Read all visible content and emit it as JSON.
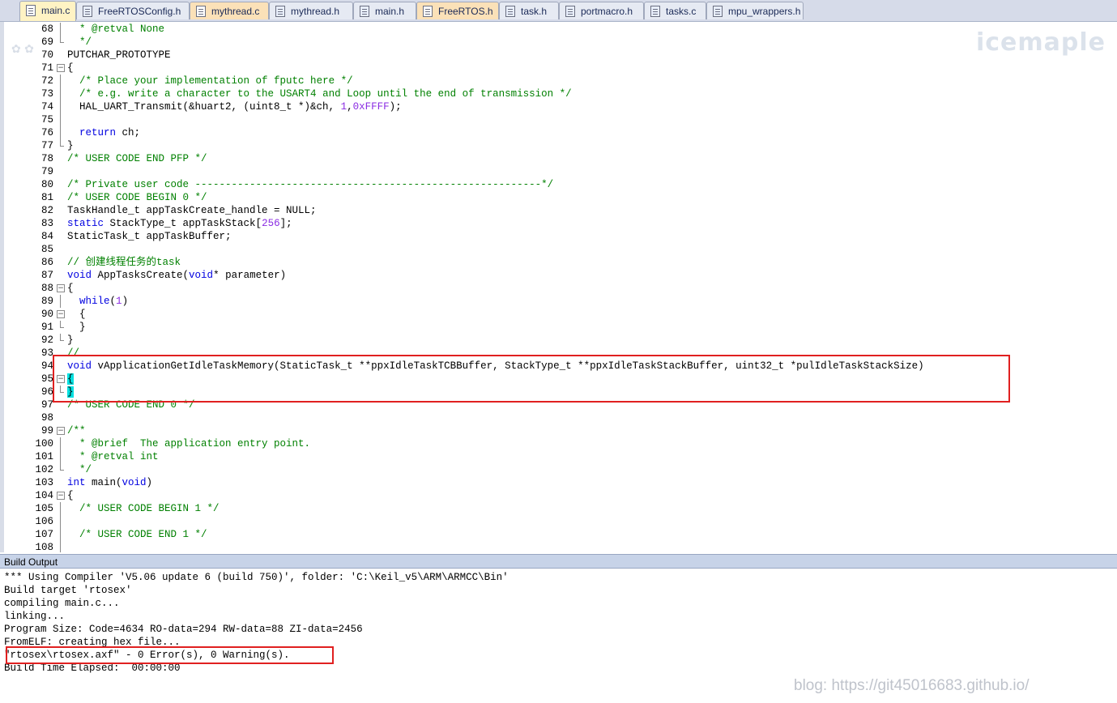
{
  "tabs": [
    {
      "label": "main.c",
      "kind": "c",
      "active": true
    },
    {
      "label": "FreeRTOSConfig.h",
      "kind": "h"
    },
    {
      "label": "mythread.c",
      "kind": "c"
    },
    {
      "label": "mythread.h",
      "kind": "h"
    },
    {
      "label": "main.h",
      "kind": "h"
    },
    {
      "label": "FreeRTOS.h",
      "kind": "c"
    },
    {
      "label": "task.h",
      "kind": "h"
    },
    {
      "label": "portmacro.h",
      "kind": "h"
    },
    {
      "label": "tasks.c",
      "kind": "h"
    },
    {
      "label": "mpu_wrappers.h",
      "kind": "h"
    }
  ],
  "watermark_top": "icemaple",
  "editor": {
    "lines": [
      {
        "n": "68",
        "fold": "vline",
        "segs": [
          [
            "c",
            "  * @retval None"
          ]
        ]
      },
      {
        "n": "69",
        "fold": "end",
        "segs": [
          [
            "c",
            "  */"
          ]
        ]
      },
      {
        "n": "70",
        "fold": "",
        "segs": [
          [
            "p",
            "PUTCHAR_PROTOTYPE"
          ]
        ]
      },
      {
        "n": "71",
        "fold": "box",
        "segs": [
          [
            "p",
            "{"
          ]
        ]
      },
      {
        "n": "72",
        "fold": "vline",
        "segs": [
          [
            "p",
            "  "
          ],
          [
            "c",
            "/* Place your implementation of fputc here */"
          ]
        ]
      },
      {
        "n": "73",
        "fold": "vline",
        "segs": [
          [
            "p",
            "  "
          ],
          [
            "c",
            "/* e.g. write a character to the USART4 and Loop until the end of transmission */"
          ]
        ]
      },
      {
        "n": "74",
        "fold": "vline",
        "segs": [
          [
            "p",
            "  HAL_UART_Transmit(&huart2, (uint8_t *)&ch, "
          ],
          [
            "n",
            "1"
          ],
          [
            "p",
            ","
          ],
          [
            "n",
            "0xFFFF"
          ],
          [
            "p",
            ");"
          ]
        ]
      },
      {
        "n": "75",
        "fold": "vline",
        "segs": [
          [
            "p",
            ""
          ]
        ]
      },
      {
        "n": "76",
        "fold": "vline",
        "segs": [
          [
            "p",
            "  "
          ],
          [
            "k",
            "return"
          ],
          [
            "p",
            " ch;"
          ]
        ]
      },
      {
        "n": "77",
        "fold": "end",
        "segs": [
          [
            "p",
            "}"
          ]
        ]
      },
      {
        "n": "78",
        "fold": "",
        "segs": [
          [
            "c",
            "/* USER CODE END PFP */"
          ]
        ]
      },
      {
        "n": "79",
        "fold": "",
        "segs": [
          [
            "p",
            ""
          ]
        ]
      },
      {
        "n": "80",
        "fold": "",
        "segs": [
          [
            "c",
            "/* Private user code ---------------------------------------------------------*/"
          ]
        ]
      },
      {
        "n": "81",
        "fold": "",
        "segs": [
          [
            "c",
            "/* USER CODE BEGIN 0 */"
          ]
        ]
      },
      {
        "n": "82",
        "fold": "",
        "segs": [
          [
            "p",
            "TaskHandle_t appTaskCreate_handle = NULL;"
          ]
        ]
      },
      {
        "n": "83",
        "fold": "",
        "segs": [
          [
            "k",
            "static"
          ],
          [
            "p",
            " StackType_t appTaskStack["
          ],
          [
            "n",
            "256"
          ],
          [
            "p",
            "];"
          ]
        ]
      },
      {
        "n": "84",
        "fold": "",
        "segs": [
          [
            "p",
            "StaticTask_t appTaskBuffer;"
          ]
        ]
      },
      {
        "n": "85",
        "fold": "",
        "segs": [
          [
            "p",
            ""
          ]
        ]
      },
      {
        "n": "86",
        "fold": "",
        "segs": [
          [
            "c",
            "// 创建线程任务的task"
          ]
        ]
      },
      {
        "n": "87",
        "fold": "",
        "segs": [
          [
            "k",
            "void"
          ],
          [
            "p",
            " AppTasksCreate("
          ],
          [
            "k",
            "void"
          ],
          [
            "p",
            "* parameter)"
          ]
        ]
      },
      {
        "n": "88",
        "fold": "box",
        "segs": [
          [
            "p",
            "{"
          ]
        ]
      },
      {
        "n": "89",
        "fold": "vline",
        "segs": [
          [
            "p",
            "  "
          ],
          [
            "k",
            "while"
          ],
          [
            "p",
            "("
          ],
          [
            "n",
            "1"
          ],
          [
            "p",
            ")"
          ]
        ]
      },
      {
        "n": "90",
        "fold": "box",
        "segs": [
          [
            "p",
            "  {"
          ]
        ]
      },
      {
        "n": "91",
        "fold": "end",
        "segs": [
          [
            "p",
            "  }"
          ]
        ]
      },
      {
        "n": "92",
        "fold": "end",
        "segs": [
          [
            "p",
            "}"
          ]
        ]
      },
      {
        "n": "93",
        "fold": "",
        "segs": [
          [
            "c",
            "//"
          ]
        ]
      },
      {
        "n": "94",
        "fold": "",
        "segs": [
          [
            "k",
            "void"
          ],
          [
            "p",
            " vApplicationGetIdleTaskMemory(StaticTask_t **ppxIdleTaskTCBBuffer, StackType_t **ppxIdleTaskStackBuffer, uint32_t *pulIdleTaskStackSize)"
          ]
        ]
      },
      {
        "n": "95",
        "fold": "box",
        "segs": [
          [
            "h",
            "{"
          ]
        ]
      },
      {
        "n": "96",
        "fold": "end",
        "segs": [
          [
            "h",
            "}"
          ]
        ]
      },
      {
        "n": "97",
        "fold": "",
        "segs": [
          [
            "c",
            "/* USER CODE END 0 */"
          ]
        ]
      },
      {
        "n": "98",
        "fold": "",
        "segs": [
          [
            "p",
            ""
          ]
        ]
      },
      {
        "n": "99",
        "fold": "box",
        "segs": [
          [
            "c",
            "/**"
          ]
        ]
      },
      {
        "n": "100",
        "fold": "vline",
        "segs": [
          [
            "c",
            "  * @brief  The application entry point."
          ]
        ]
      },
      {
        "n": "101",
        "fold": "vline",
        "segs": [
          [
            "c",
            "  * @retval int"
          ]
        ]
      },
      {
        "n": "102",
        "fold": "end",
        "segs": [
          [
            "c",
            "  */"
          ]
        ]
      },
      {
        "n": "103",
        "fold": "",
        "segs": [
          [
            "k",
            "int"
          ],
          [
            "p",
            " main("
          ],
          [
            "k",
            "void"
          ],
          [
            "p",
            ")"
          ]
        ]
      },
      {
        "n": "104",
        "fold": "box",
        "segs": [
          [
            "p",
            "{"
          ]
        ]
      },
      {
        "n": "105",
        "fold": "vline",
        "segs": [
          [
            "p",
            "  "
          ],
          [
            "c",
            "/* USER CODE BEGIN 1 */"
          ]
        ]
      },
      {
        "n": "106",
        "fold": "vline",
        "segs": [
          [
            "p",
            ""
          ]
        ]
      },
      {
        "n": "107",
        "fold": "vline",
        "segs": [
          [
            "p",
            "  "
          ],
          [
            "c",
            "/* USER CODE END 1 */"
          ]
        ]
      },
      {
        "n": "108",
        "fold": "vline",
        "segs": [
          [
            "p",
            ""
          ]
        ]
      }
    ]
  },
  "build": {
    "header": "Build Output",
    "lines": [
      "*** Using Compiler 'V5.06 update 6 (build 750)', folder: 'C:\\Keil_v5\\ARM\\ARMCC\\Bin'",
      "Build target 'rtosex'",
      "compiling main.c...",
      "linking...",
      "Program Size: Code=4634 RO-data=294 RW-data=88 ZI-data=2456",
      "FromELF: creating hex file...",
      "\"rtosex\\rtosex.axf\" - 0 Error(s), 0 Warning(s).",
      "Build Time Elapsed:  00:00:00"
    ]
  },
  "watermark_blog": "blog: https://git45016683.github.io/"
}
